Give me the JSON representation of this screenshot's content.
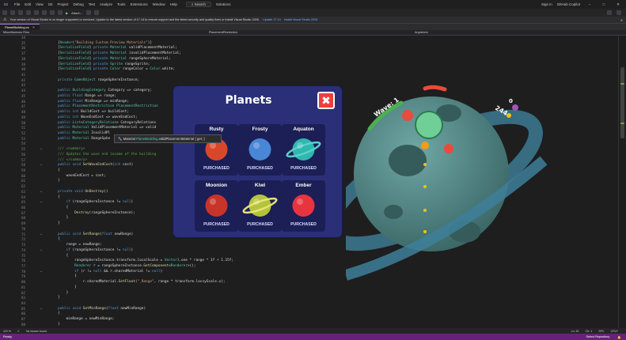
{
  "menu": {
    "items": [
      "File",
      "Edit",
      "View",
      "Git",
      "Project",
      "Debug",
      "Test",
      "Analyze",
      "Tools",
      "Extensions",
      "Window",
      "Help"
    ],
    "search": "Search",
    "solution": "Solution1",
    "sign_in": "Sign in",
    "copilot": "GitHub Copilot"
  },
  "toolbar": {
    "attach": "Attach..."
  },
  "infobar": {
    "message": "Your version of Visual Studio is no longer supported or serviced. Update to the latest version of 17.14 to ensure support and the latest security and quality fixes or install Visual Studio 2026.",
    "update_link": "Update 17.14",
    "install_link": "Install Visual Studio 2026"
  },
  "tabs": [
    {
      "label": "PlanetBuilding.cs"
    }
  ],
  "navbar": {
    "project": "Miscellaneous Files",
    "class": "PlacementRestriction",
    "member": "Anywhere"
  },
  "editor": {
    "line_numbers": [
      "34",
      "35",
      "36",
      "37",
      "38",
      "39",
      "40",
      "41",
      "42",
      "43",
      "44",
      "45",
      "46",
      "47",
      "48",
      "49",
      "50",
      "51",
      "52",
      "53",
      "54",
      "55",
      "56",
      "57",
      "58",
      "59",
      "60",
      "61",
      "62",
      "63",
      "64",
      "65",
      "66",
      "67",
      "68",
      "69",
      "70",
      "71",
      "72",
      "73",
      "74",
      "75",
      "76",
      "77",
      "78",
      "79",
      "80",
      "81",
      "82",
      "83",
      "84",
      "85",
      "86",
      "87",
      "88"
    ],
    "lines": [
      "",
      "[Header(\"Building Custom Preview Materials\")]",
      "[SerializeField] private Material validPlacementMaterial;",
      "[SerializeField] private Material invalidPlacementMaterial;",
      "[SerializeField] private Material rangeSphereMaterial;",
      "[SerializeField] private Sprite rangeSprite;",
      "[SerializeField] private Color rangeColor = Color.white;",
      "",
      "private GameObject rangeSphereInstance;",
      "",
      "public BuildingCategory Category => category;",
      "public float Range => range;",
      "public float MinRange => minRange;",
      "public PlacementRestriction PlacementRestriction",
      "public int BuildCost => buildCost;",
      "public int WaveEndCost => waveEndCost;",
      "public List<CategoryRelation> CategoryRelations",
      "public Material ValidPlacementMaterial => valid",
      "public Material InvalidPl",
      "public Material RangeSphe",
      "",
      "/// <summary>",
      "/// Updates the wave end income of the building",
      "/// </summary>",
      "public void SetWaveEndCost(int cost)",
      "{",
      "    waveEndCost = cost;",
      "}",
      "",
      "private void OnDestroy()",
      "{",
      "    if (rangeSphereInstance != null)",
      "    {",
      "        Destroy(rangeSphereInstance);",
      "    }",
      "}",
      "",
      "public void SetRange(float newRange)",
      "{",
      "    range = newRange;",
      "    if (rangeSphereInstance != null)",
      "    {",
      "        rangeSphereInstance.transform.localScale = Vector3.one * range * 1f + 1.15f;",
      "        Renderer r = rangeSphereInstance.GetComponent<Renderer>();",
      "        if (r != null && r.sharedMaterial != null)",
      "        {",
      "            r.sharedMaterial.SetFloat(\"_Range\", range * transform.lossyScale.x);",
      "        }",
      "    }",
      "}",
      "",
      "public void SetMinRange(float newMinRange)",
      "{",
      "    minRange = newMinRange;",
      "}"
    ]
  },
  "tooltip": {
    "prefix": "Material ",
    "type": "PlanetBuilding",
    "member": ".validPlacementMaterial { get; }"
  },
  "game": {
    "wave_label": "Wave: 1",
    "score": "244",
    "currency": "0"
  },
  "panel": {
    "title": "Planets",
    "close": "✖",
    "planets": [
      {
        "name": "Rusty",
        "status": "PURCHASED",
        "color": "#d9472b"
      },
      {
        "name": "Frosty",
        "status": "PURCHASED",
        "color": "#4a86d6"
      },
      {
        "name": "Aquaton",
        "status": "PURCHASED",
        "color": "#2fb7b0"
      },
      {
        "name": "Moonion",
        "status": "PURCHASED",
        "color": "#c8342a"
      },
      {
        "name": "Kiwi",
        "status": "PURCHASED",
        "color": "#b4c43a"
      },
      {
        "name": "Ember",
        "status": "PURCHASED",
        "color": "#e8343f"
      }
    ]
  },
  "edstatus": {
    "zoom": "110 %",
    "issues": "No issues found",
    "position": "Ln: 61",
    "col": "Ch: 1",
    "mode": "SPC",
    "eol": "CRLF"
  },
  "statusbar": {
    "left": "Ready",
    "right": "Select Repository"
  }
}
